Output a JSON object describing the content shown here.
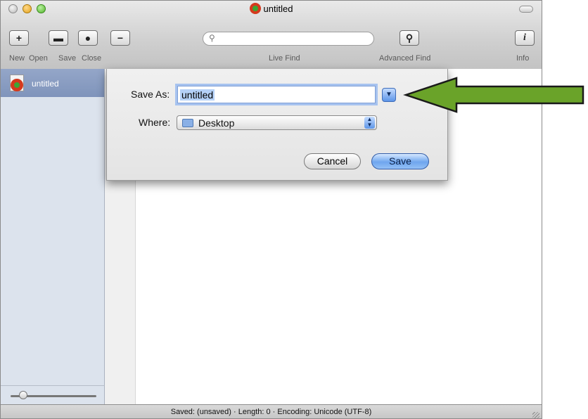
{
  "window": {
    "title": "untitled"
  },
  "toolbar": {
    "buttons": [
      {
        "label": "New",
        "glyph": "+"
      },
      {
        "label": "Open",
        "glyph": "▬"
      },
      {
        "label": "Save",
        "glyph": "●"
      },
      {
        "label": "Close",
        "glyph": "−"
      }
    ],
    "search_label": "Live Find",
    "advanced_label": "Advanced Find",
    "info_label": "Info",
    "info_glyph": "i"
  },
  "sidebar": {
    "items": [
      {
        "label": "untitled"
      }
    ]
  },
  "save_sheet": {
    "save_as_label": "Save As:",
    "filename_value": "untitled",
    "where_label": "Where:",
    "location_value": "Desktop",
    "cancel_label": "Cancel",
    "save_label": "Save"
  },
  "status": {
    "text": "Saved: (unsaved)  ·  Length: 0  ·  Encoding: Unicode (UTF-8)"
  },
  "colors": {
    "arrow": "#6aa329",
    "default_button": "#6fa6ee"
  }
}
